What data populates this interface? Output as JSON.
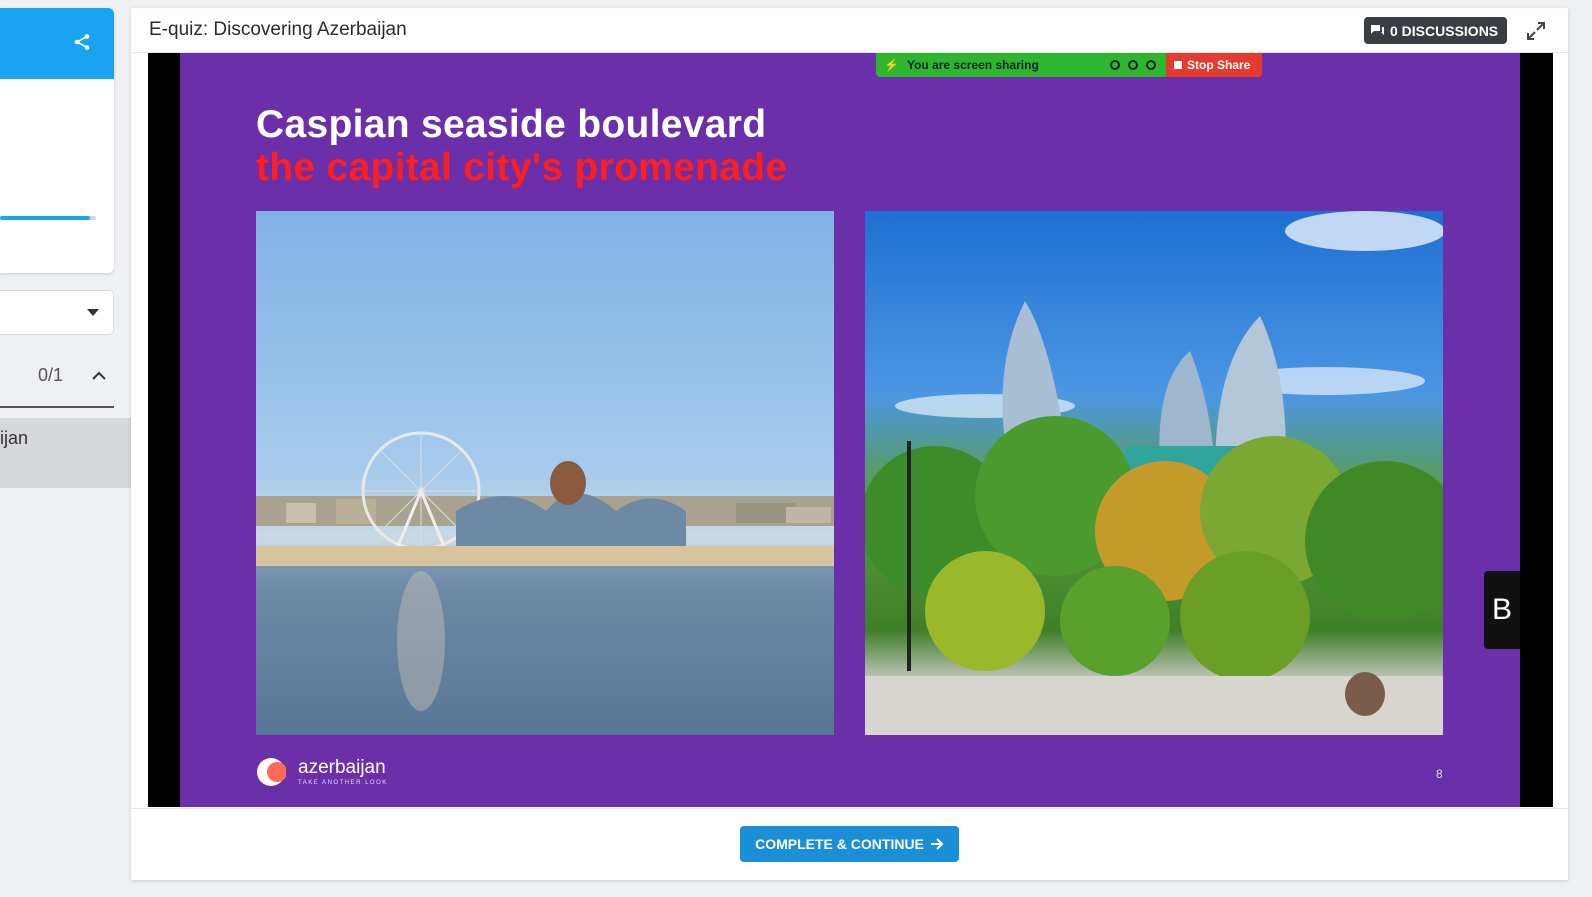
{
  "sidebar": {
    "progress": 0.94,
    "section": {
      "count": "0/1"
    },
    "lesson": {
      "label": "ijan"
    }
  },
  "header": {
    "title": "E-quiz: Discovering Azerbaijan",
    "discussions_label": "0 DISCUSSIONS"
  },
  "slide": {
    "sharing_text": "You are screen sharing",
    "stop_share_label": "Stop Share",
    "title_line1": "Caspian seaside boulevard",
    "title_line2": "the capital city's promenade",
    "brand": "azerbaijan",
    "brand_tagline": "TAKE ANOTHER LOOK",
    "page_number": "8",
    "side_tab_glyph": "B",
    "colors": {
      "background": "#6a2fa9",
      "title": "#ffffff",
      "subtitle": "#ff1d1d"
    }
  },
  "footer": {
    "complete_label": "COMPLETE & CONTINUE"
  },
  "colors": {
    "accent": "#1aa3ee",
    "button": "#1a8fd8"
  }
}
